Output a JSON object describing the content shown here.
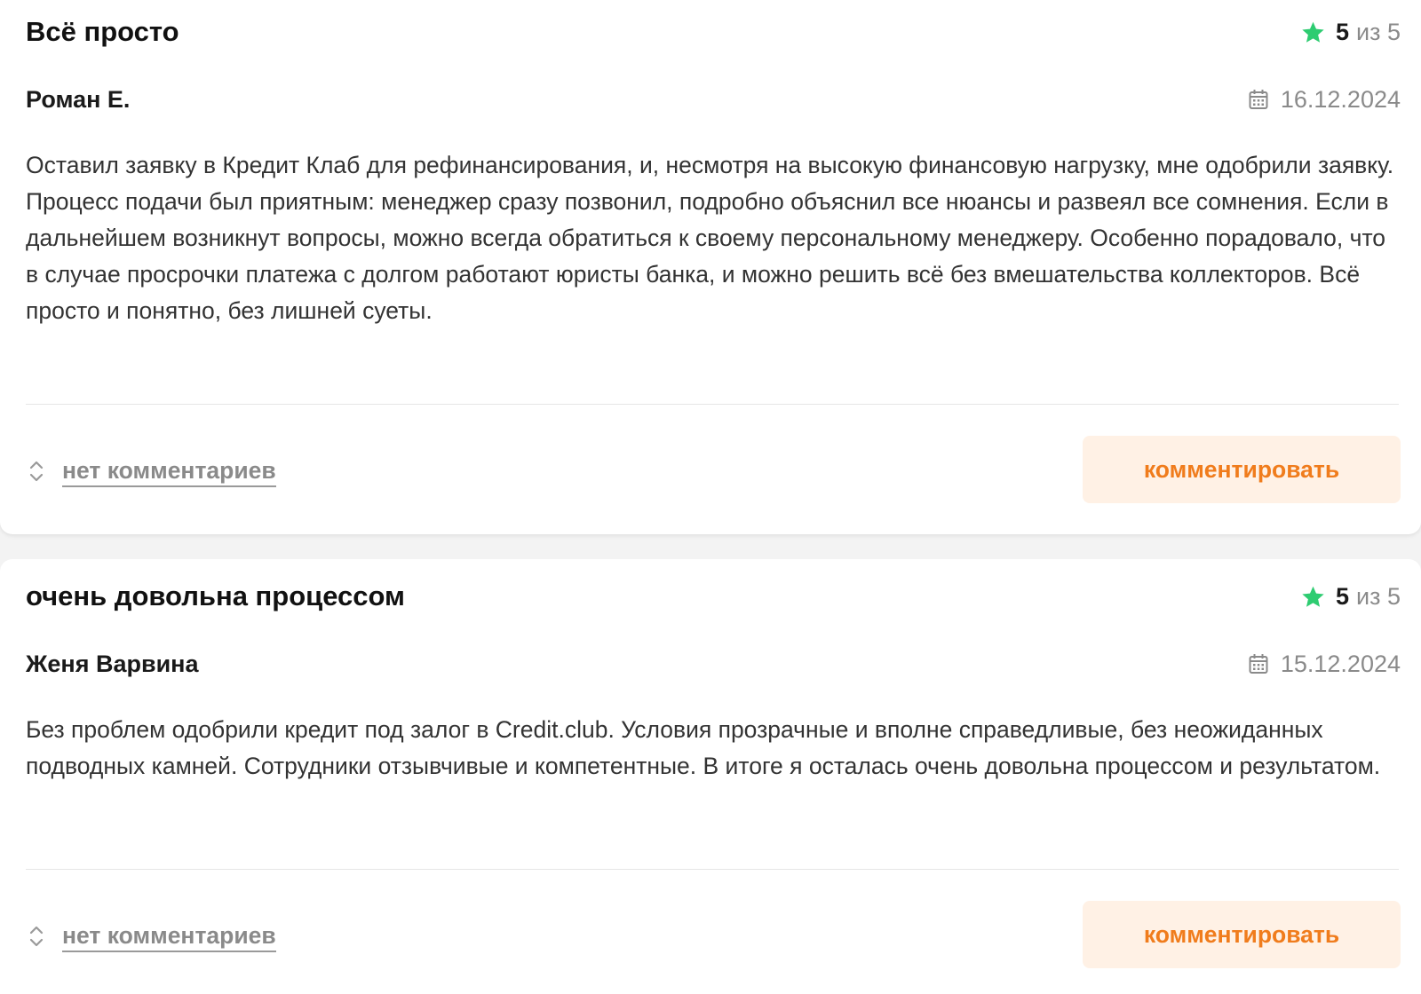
{
  "reviews": [
    {
      "title": "Всё просто",
      "rating": {
        "score": "5",
        "of_label": "из 5",
        "star_color": "#2ecc71",
        "icon": "star-icon"
      },
      "author": "Роман Е.",
      "date": "16.12.2024",
      "text": "Оставил заявку в Кредит Клаб для рефинансирования, и, несмотря на высокую финансовую нагрузку, мне одобрили заявку. Процесс подачи был приятным: менеджер сразу позвонил, подробно объяснил все нюансы и развеял все сомнения. Если в дальнейшем возникнут вопросы, можно всегда обратиться к своему персональному менеджеру. Особенно порадовало, что в случае просрочки платежа с долгом работают юристы банка, и можно решить всё без вмешательства коллекторов. Всё просто и понятно, без лишней суеты.",
      "comments_label": "нет комментариев",
      "comment_button": "комментировать"
    },
    {
      "title": "очень довольна процессом",
      "rating": {
        "score": "5",
        "of_label": "из 5",
        "star_color": "#2ecc71",
        "icon": "star-icon"
      },
      "author": "Женя Варвина",
      "date": "15.12.2024",
      "text": "Без проблем одобрили кредит под залог в Credit.club. Условия прозрачные и вполне справедливые, без неожиданных подводных камней. Сотрудники отзывчивые и компетентные. В итоге я осталась очень довольна процессом и результатом.",
      "comments_label": "нет комментариев",
      "comment_button": "комментировать"
    }
  ],
  "colors": {
    "accent": "#f07c1c",
    "button_bg": "#fff1e5",
    "star": "#2ecc71",
    "muted": "#8a8a8a"
  }
}
